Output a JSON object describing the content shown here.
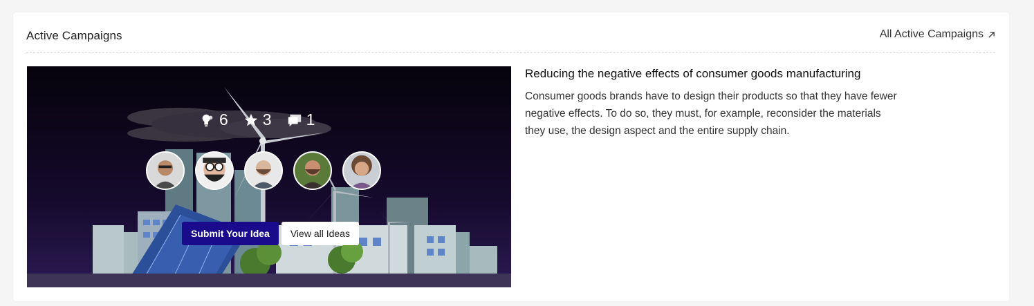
{
  "section": {
    "title": "Active Campaigns",
    "all_link_label": "All Active Campaigns"
  },
  "campaign": {
    "title": "Reducing the negative effects of consumer goods manufacturing",
    "description": "Consumer goods brands have to design their products so that they have fewer negative effects. To do so, they must, for example, reconsider the materials they use, the design aspect and the entire supply chain.",
    "stats": {
      "ideas": "6",
      "stars": "3",
      "comments": "1"
    },
    "avatars": [
      "avatar-1",
      "avatar-2",
      "avatar-3",
      "avatar-4",
      "avatar-5"
    ],
    "submit_label": "Submit Your Idea",
    "view_label": "View all Ideas"
  },
  "colors": {
    "primary_button": "#1a0b8c",
    "hero_background": "#0a0612"
  }
}
